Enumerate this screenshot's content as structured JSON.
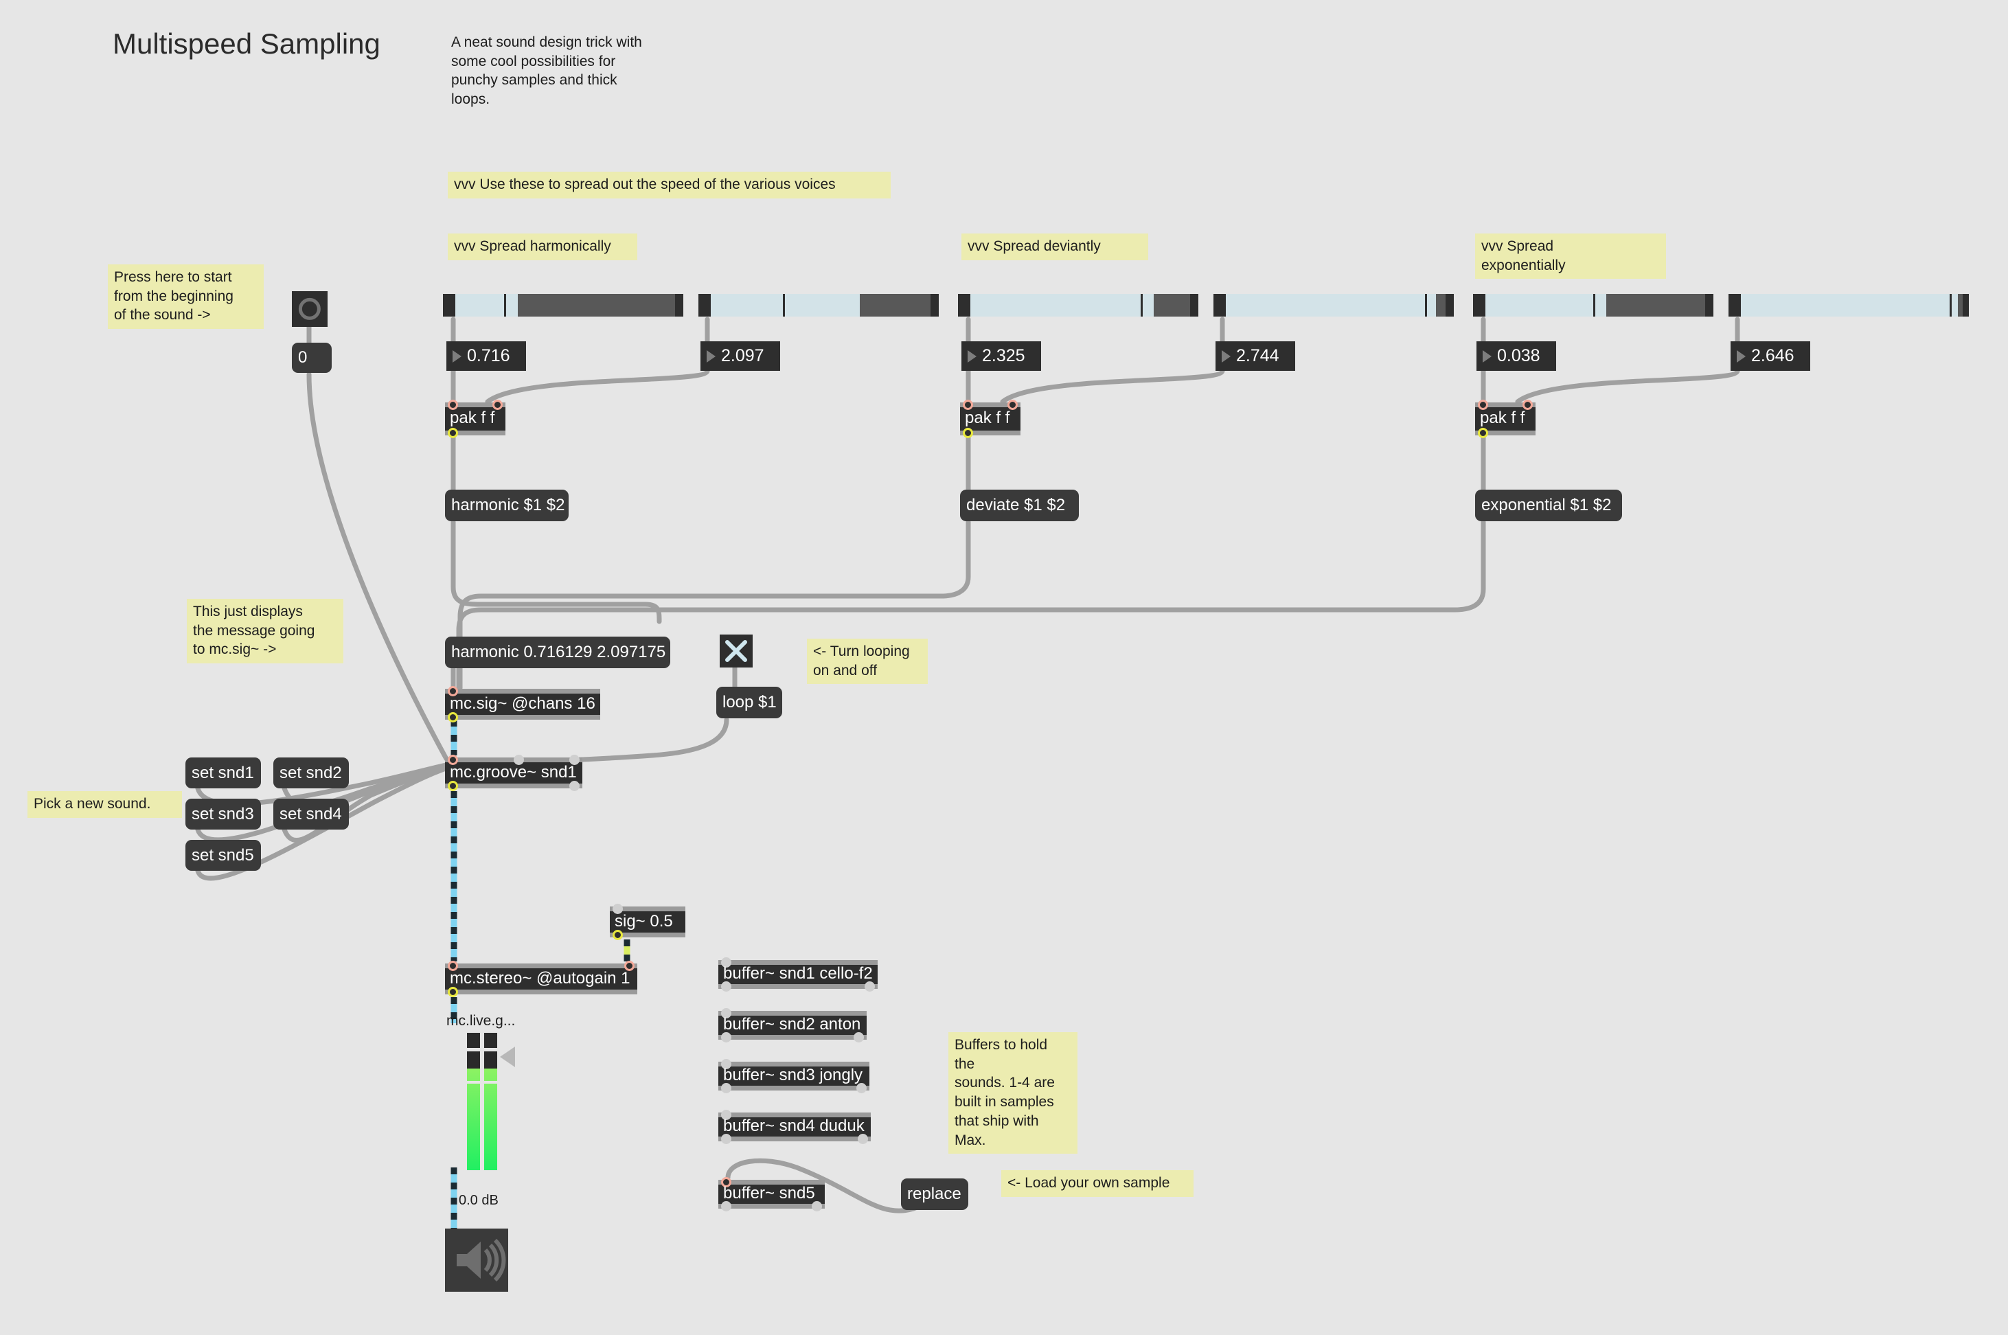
{
  "header": {
    "title": "Multispeed Sampling",
    "description": "A neat sound design trick with some cool possibilities for punchy samples and thick loops."
  },
  "comments": {
    "spread_intro": "vvv Use these to spread out the speed of the various voices",
    "spread_harmonically": "vvv Spread harmonically",
    "spread_deviantly": "vvv Spread deviantly",
    "spread_exponentially": "vvv Spread\nexponentially",
    "press_here": "Press here to start\nfrom the beginning\nof the sound ->",
    "displays_message": "This just displays\nthe message going\nto mc.sig~ ->",
    "turn_looping": "<- Turn looping\non and off",
    "pick_sound": "Pick a new sound.",
    "buffers_note": "Buffers to hold the\nsounds. 1-4 are\nbuilt in samples\nthat ship with\nMax.",
    "load_own_sample": "<- Load your own sample"
  },
  "sliders": [
    {
      "name": "harmonic-low",
      "value": 0.716,
      "fill_start": 0.035,
      "fill_end": 0.31,
      "sel_start": 0.31,
      "sel_end": 0.965
    },
    {
      "name": "harmonic-high",
      "value": 2.097,
      "fill_start": 0.035,
      "fill_end": 0.66,
      "sel_start": 0.67,
      "sel_end": 0.965
    },
    {
      "name": "deviant-low",
      "value": 2.325,
      "fill_start": 0.035,
      "fill_end": 0.79,
      "sel_start": 0.815,
      "sel_end": 0.965
    },
    {
      "name": "deviant-high",
      "value": 2.744,
      "fill_start": 0.035,
      "fill_end": 0.915,
      "sel_start": 0.925,
      "sel_end": 0.965
    },
    {
      "name": "exponential-low",
      "value": 0.038,
      "fill_start": 0.035,
      "fill_end": 0.53,
      "sel_start": 0.555,
      "sel_end": 0.965
    },
    {
      "name": "exponential-high",
      "value": 2.646,
      "fill_start": 0.035,
      "fill_end": 0.945,
      "sel_start": 0.955,
      "sel_end": 0.975
    }
  ],
  "numbers": {
    "harmonic_low": "0.716",
    "harmonic_high": "2.097",
    "deviant_low": "2.325",
    "deviant_high": "2.744",
    "exponential_low": "0.038",
    "exponential_high": "2.646"
  },
  "objects": {
    "pak_harmonic": "pak f f",
    "pak_deviant": "pak f f",
    "pak_exponential": "pak f f",
    "mc_sig": "mc.sig~ @chans 16",
    "mc_groove": "mc.groove~ snd1",
    "mc_stereo": "mc.stereo~ @autogain 1",
    "sig": "sig~ 0.5",
    "buffer1": "buffer~ snd1 cello-f2",
    "buffer2": "buffer~ snd2 anton",
    "buffer3": "buffer~ snd3 jongly",
    "buffer4": "buffer~ snd4 duduk",
    "buffer5": "buffer~ snd5"
  },
  "messages": {
    "zero": "0",
    "harmonic_tmpl": "harmonic $1 $2",
    "deviate_tmpl": "deviate $1 $2",
    "exponential_tmpl": "exponential $1 $2",
    "harmonic_display": "harmonic 0.716129 2.097175",
    "loop_tmpl": "loop $1",
    "set_snd1": "set snd1",
    "set_snd2": "set snd2",
    "set_snd3": "set snd3",
    "set_snd4": "set snd4",
    "set_snd5": "set snd5",
    "replace": "replace"
  },
  "gain": {
    "label": "mc.live.g...",
    "db": "0.0 dB"
  },
  "colors": {
    "canvas": "#e6e6e6",
    "object_fill": "#2e2e2e",
    "object_bar": "#9a9a9a",
    "message_fill": "#3a3a3a",
    "comment_fill": "#ececb0",
    "slider_fill": "#d3e3e8",
    "slider_sel": "#585858",
    "cord_color": "#a0a0a0",
    "signal_cord": "#7fd3f0",
    "meter_green": "#35ef63",
    "toggle_x": "#cfe6ee",
    "inlet_hot": "#f3a999",
    "outlet_signal": "#e8e83f"
  }
}
